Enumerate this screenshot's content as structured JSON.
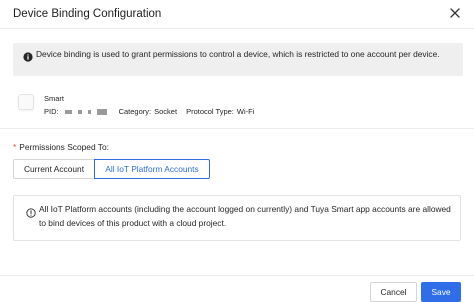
{
  "dialog": {
    "title": "Device Binding Configuration"
  },
  "info_banner": {
    "text": "Device binding is used to grant permissions to control a device, which is restricted to one account per device."
  },
  "device": {
    "name": "Smart",
    "pid_label": "PID:",
    "category_label": "Category:",
    "category_value": "Socket",
    "protocol_label": "Protocol Type:",
    "protocol_value": "Wi-Fi"
  },
  "permissions": {
    "label": "Permissions Scoped To:",
    "required_mark": "*",
    "options": [
      "Current Account",
      "All IoT Platform Accounts"
    ],
    "selected": "All IoT Platform Accounts"
  },
  "note": {
    "text": "All IoT Platform accounts (including the account logged on currently) and Tuya Smart app accounts are allowed to bind devices of this product with a cloud project."
  },
  "footer": {
    "cancel_label": "Cancel",
    "save_label": "Save"
  },
  "colors": {
    "primary": "#2f6ee8",
    "required": "#e8463a",
    "banner_bg": "#efefef"
  },
  "icons": {
    "banner": "info-filled-icon",
    "note": "info-outline-icon",
    "close": "close-icon"
  }
}
